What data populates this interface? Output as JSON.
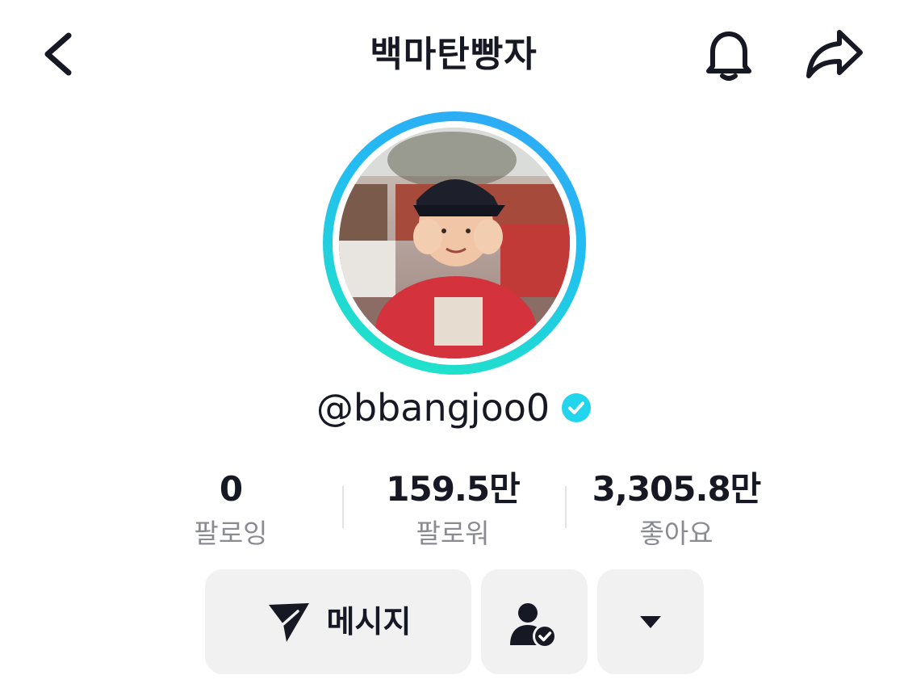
{
  "header": {
    "title": "백마탄빵자",
    "back_icon": "chevron-left-icon",
    "bell_icon": "bell-icon",
    "share_icon": "share-arrow-icon"
  },
  "profile": {
    "avatar": "profile-photo",
    "handle": "@bbangjoo0",
    "verified_icon": "verified-check-icon",
    "ring_colors": [
      "#31a5f6",
      "#22e6c6"
    ],
    "verified_color": "#20d5ec"
  },
  "stats": [
    {
      "value": "0",
      "label": "팔로잉"
    },
    {
      "value": "159.5만",
      "label": "팔로워"
    },
    {
      "value": "3,305.8만",
      "label": "좋아요"
    }
  ],
  "actions": {
    "message_label": "메시지",
    "message_icon": "send-icon",
    "friends_icon": "user-check-icon",
    "more_icon": "caret-down-icon"
  }
}
